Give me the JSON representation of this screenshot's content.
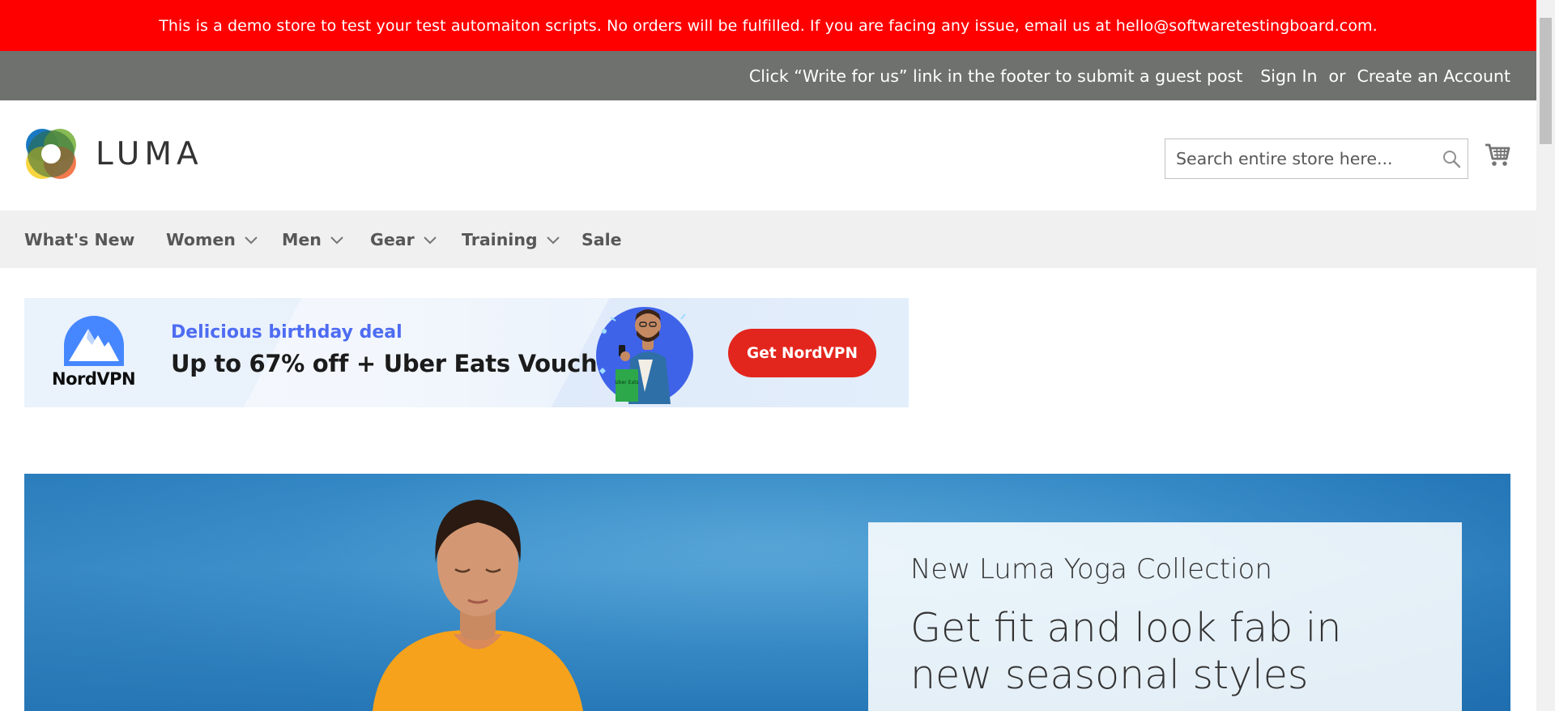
{
  "notice": {
    "text": "This is a demo store to test your test automaiton scripts. No orders will be fulfilled. If you are facing any issue, email us at hello@softwaretestingboard.com."
  },
  "panel": {
    "promo": "Click “Write for us” link in the footer to submit a guest post",
    "sign_in": "Sign In",
    "or": "or",
    "create_account": "Create an Account"
  },
  "header": {
    "logo_text": "LUMA",
    "search_placeholder": "Search entire store here...",
    "search_icon": "search-icon",
    "cart_icon": "cart-icon"
  },
  "nav": {
    "items": [
      {
        "label": "What's New",
        "has_dropdown": false
      },
      {
        "label": "Women",
        "has_dropdown": true
      },
      {
        "label": "Men",
        "has_dropdown": true
      },
      {
        "label": "Gear",
        "has_dropdown": true
      },
      {
        "label": "Training",
        "has_dropdown": true
      },
      {
        "label": "Sale",
        "has_dropdown": false
      }
    ]
  },
  "ad": {
    "brand": "NordVPN",
    "subtitle": "Delicious birthday deal",
    "headline": "Up to 67% off + Uber Eats Voucher",
    "bag_text": "Uber Eats",
    "cta": "Get NordVPN"
  },
  "hero": {
    "line1": "New Luma Yoga Collection",
    "line2": "Get fit and look fab in new seasonal styles"
  },
  "colors": {
    "notice_bg": "#ff0000",
    "panel_bg": "#6e716e",
    "nav_bg": "#f0f0f0",
    "ad_cta_bg": "#e3261d",
    "ad_subtitle": "#4e6cf2",
    "hero_bg": "#2f85c2"
  }
}
